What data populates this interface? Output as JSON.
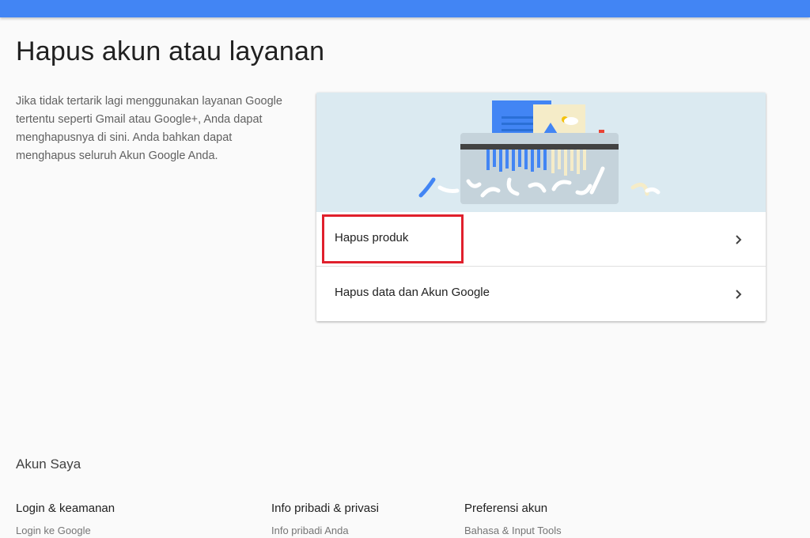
{
  "header": {
    "accent": "#4285f4"
  },
  "page": {
    "title": "Hapus akun atau layanan",
    "intro": "Jika tidak tertarik lagi menggunakan layanan Google tertentu seperti Gmail atau Google+, Anda dapat menghapusnya di sini. Anda bahkan dapat menghapus seluruh Akun Google Anda."
  },
  "card": {
    "illustration": "shredder-illustration",
    "rows": [
      {
        "label": "Hapus produk",
        "icon": "chevron-right-icon"
      },
      {
        "label": "Hapus data dan Akun Google",
        "icon": "chevron-right-icon"
      }
    ]
  },
  "highlight": {
    "color": "#e0202c",
    "target": "Hapus produk"
  },
  "footer": {
    "title": "Akun Saya",
    "columns": [
      {
        "heading": "Login & keamanan",
        "link": "Login ke Google"
      },
      {
        "heading": "Info pribadi & privasi",
        "link": "Info pribadi Anda"
      },
      {
        "heading": "Preferensi akun",
        "link": "Bahasa & Input Tools"
      }
    ]
  }
}
